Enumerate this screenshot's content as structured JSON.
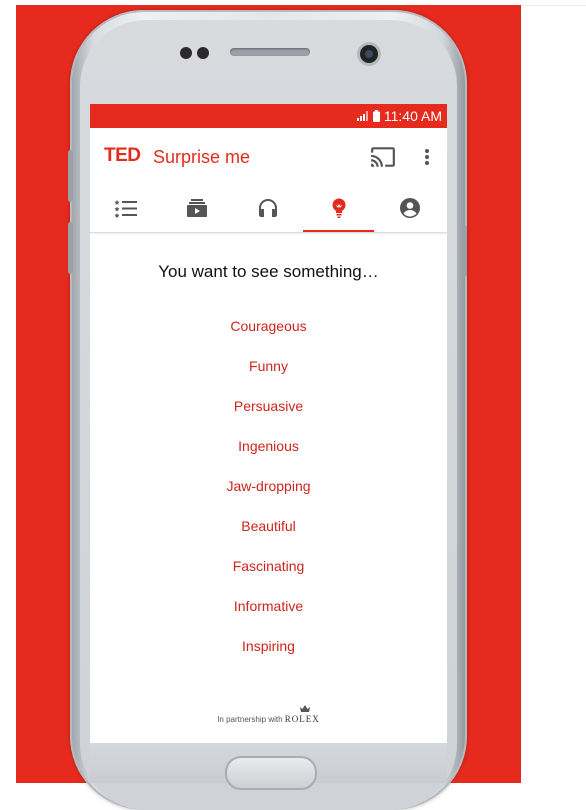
{
  "status_bar": {
    "time": "11:40 AM"
  },
  "app_bar": {
    "logo": "TED",
    "title": "Surprise me"
  },
  "prompt": "You want to see something…",
  "options": [
    "Courageous",
    "Funny",
    "Persuasive",
    "Ingenious",
    "Jaw-dropping",
    "Beautiful",
    "Fascinating",
    "Informative",
    "Inspiring"
  ],
  "footer": {
    "partner_text": "In partnership with",
    "partner_brand": "ROLEX"
  },
  "colors": {
    "brand": "#e62b1e",
    "option_text": "#d0251b",
    "background": "#e62b1e"
  },
  "icons": {
    "tabs": [
      "playlist-icon",
      "videos-icon",
      "headphones-icon",
      "lightbulb-icon",
      "profile-icon"
    ],
    "app_bar": [
      "cast-icon",
      "more-vert-icon"
    ]
  }
}
